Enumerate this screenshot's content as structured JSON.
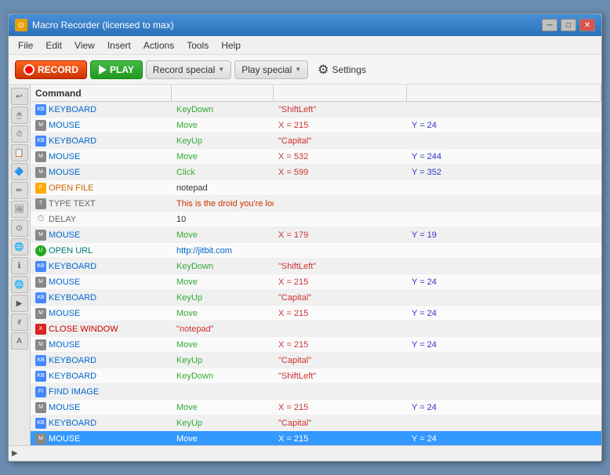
{
  "window": {
    "title": "Macro Recorder (licensed to max)",
    "icon": "⊙"
  },
  "menu": {
    "items": [
      "File",
      "Edit",
      "View",
      "Insert",
      "Actions",
      "Tools",
      "Help"
    ]
  },
  "toolbar": {
    "record_label": "RECORD",
    "play_label": "PLAY",
    "record_special_label": "Record special",
    "play_special_label": "Play special",
    "settings_label": "Settings"
  },
  "table": {
    "headers": [
      "Command",
      "",
      "",
      ""
    ],
    "rows": [
      {
        "icon": "KB",
        "type": "KEYBOARD",
        "typeColor": "blue",
        "action": "KeyDown",
        "param1": "\"ShiftLeft\"",
        "param2": ""
      },
      {
        "icon": "M",
        "type": "MOUSE",
        "typeColor": "blue",
        "action": "Move",
        "param1": "X = 215",
        "param2": "Y = 24"
      },
      {
        "icon": "KB",
        "type": "KEYBOARD",
        "typeColor": "blue",
        "action": "KeyUp",
        "param1": "\"Capital\"",
        "param2": ""
      },
      {
        "icon": "M",
        "type": "MOUSE",
        "typeColor": "blue",
        "action": "Move",
        "param1": "X = 532",
        "param2": "Y = 244"
      },
      {
        "icon": "M",
        "type": "MOUSE",
        "typeColor": "blue",
        "action": "Click",
        "param1": "X = 599",
        "param2": "Y = 352"
      },
      {
        "icon": "F",
        "type": "OPEN FILE",
        "typeColor": "orange",
        "action": "notepad",
        "param1": "",
        "param2": ""
      },
      {
        "icon": "T",
        "type": "TYPE TEXT",
        "typeColor": "gray",
        "action": "This is the droid you're looking for!",
        "param1": "",
        "param2": ""
      },
      {
        "icon": "D",
        "type": "DELAY",
        "typeColor": "gray",
        "action": "10",
        "param1": "",
        "param2": ""
      },
      {
        "icon": "M",
        "type": "MOUSE",
        "typeColor": "blue",
        "action": "Move",
        "param1": "X = 179",
        "param2": "Y = 19"
      },
      {
        "icon": "U",
        "type": "OPEN URL",
        "typeColor": "teal",
        "action": "http://jitbit.com",
        "param1": "",
        "param2": ""
      },
      {
        "icon": "KB",
        "type": "KEYBOARD",
        "typeColor": "blue",
        "action": "KeyDown",
        "param1": "\"ShiftLeft\"",
        "param2": ""
      },
      {
        "icon": "M",
        "type": "MOUSE",
        "typeColor": "blue",
        "action": "Move",
        "param1": "X = 215",
        "param2": "Y = 24"
      },
      {
        "icon": "KB",
        "type": "KEYBOARD",
        "typeColor": "blue",
        "action": "KeyUp",
        "param1": "\"Capital\"",
        "param2": ""
      },
      {
        "icon": "M",
        "type": "MOUSE",
        "typeColor": "blue",
        "action": "Move",
        "param1": "X = 215",
        "param2": "Y = 24"
      },
      {
        "icon": "X",
        "type": "CLOSE WINDOW",
        "typeColor": "red",
        "action": "\"notepad\"",
        "param1": "",
        "param2": ""
      },
      {
        "icon": "M",
        "type": "MOUSE",
        "typeColor": "blue",
        "action": "Move",
        "param1": "X = 215",
        "param2": "Y = 24"
      },
      {
        "icon": "KB",
        "type": "KEYBOARD",
        "typeColor": "blue",
        "action": "KeyUp",
        "param1": "\"Capital\"",
        "param2": ""
      },
      {
        "icon": "KB",
        "type": "KEYBOARD",
        "typeColor": "blue",
        "action": "KeyDown",
        "param1": "\"ShiftLeft\"",
        "param2": ""
      },
      {
        "icon": "FI",
        "type": "FIND IMAGE",
        "typeColor": "blue",
        "action": "",
        "param1": "",
        "param2": ""
      },
      {
        "icon": "M",
        "type": "MOUSE",
        "typeColor": "blue",
        "action": "Move",
        "param1": "X = 215",
        "param2": "Y = 24"
      },
      {
        "icon": "KB",
        "type": "KEYBOARD",
        "typeColor": "blue",
        "action": "KeyUp",
        "param1": "\"Capital\"",
        "param2": ""
      },
      {
        "icon": "M",
        "type": "MOUSE",
        "typeColor": "blue",
        "action": "Move",
        "param1": "X = 215",
        "param2": "Y = 24",
        "selected": true
      }
    ]
  },
  "sidebar_icons": [
    "↩",
    "🖱",
    "⏱",
    "📋",
    "🔷",
    "✏",
    "🖼",
    "⊙",
    "🌐",
    "ℹ",
    "🌐",
    "▶",
    "if"
  ]
}
